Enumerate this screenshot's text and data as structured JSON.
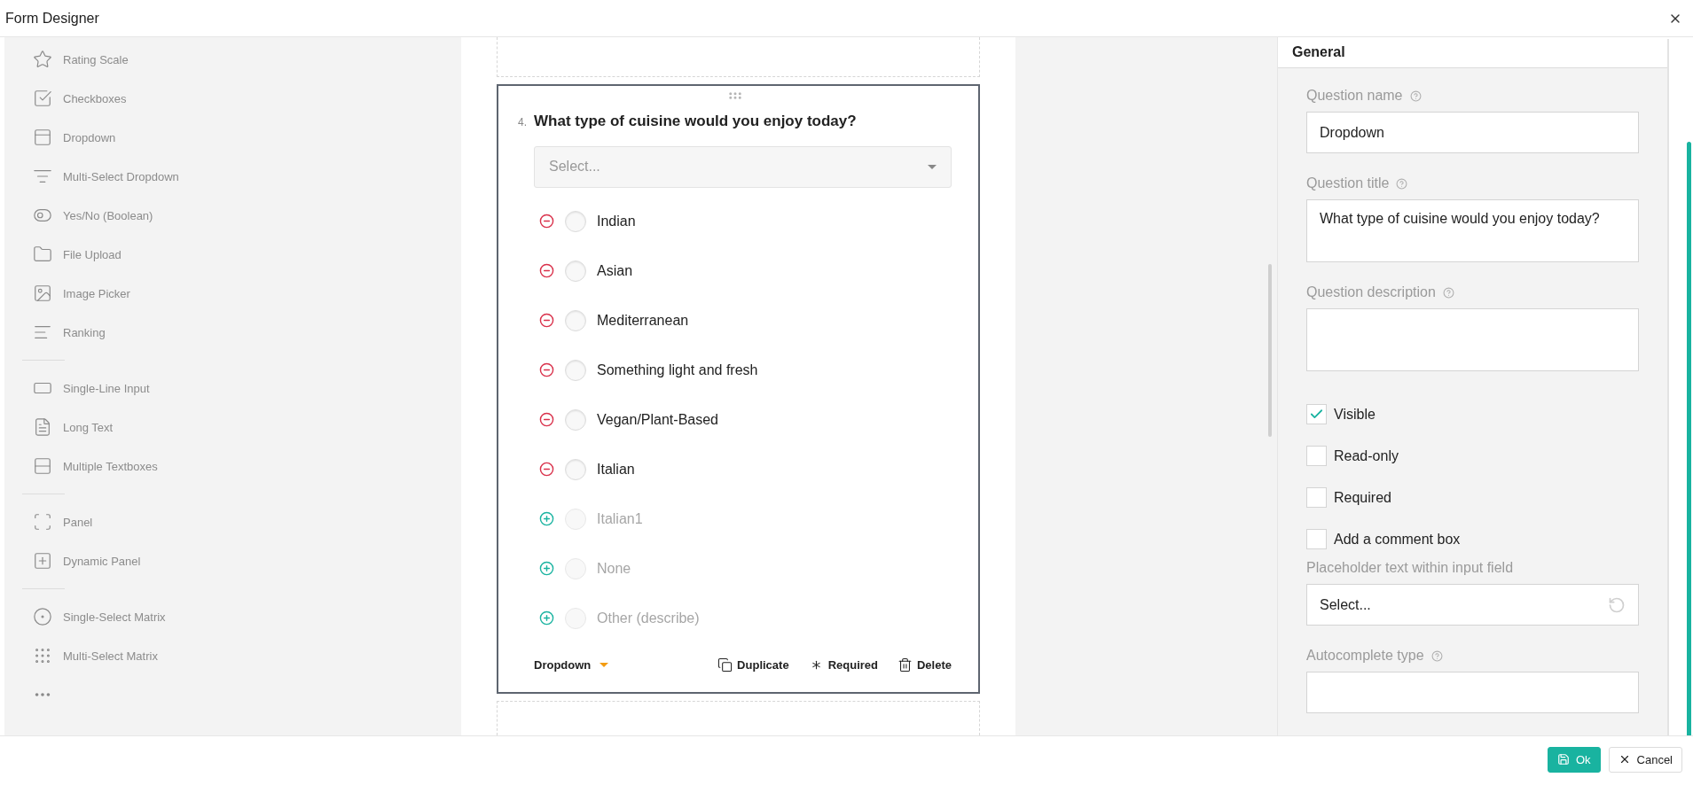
{
  "window": {
    "title": "Form Designer"
  },
  "toolbox": {
    "groups": [
      [
        {
          "label": "Rating Scale"
        },
        {
          "label": "Checkboxes"
        },
        {
          "label": "Dropdown"
        },
        {
          "label": "Multi-Select Dropdown"
        },
        {
          "label": "Yes/No (Boolean)"
        },
        {
          "label": "File Upload"
        },
        {
          "label": "Image Picker"
        },
        {
          "label": "Ranking"
        }
      ],
      [
        {
          "label": "Single-Line Input"
        },
        {
          "label": "Long Text"
        },
        {
          "label": "Multiple Textboxes"
        }
      ],
      [
        {
          "label": "Panel"
        },
        {
          "label": "Dynamic Panel"
        }
      ],
      [
        {
          "label": "Single-Select Matrix"
        },
        {
          "label": "Multi-Select Matrix"
        }
      ]
    ]
  },
  "question": {
    "number": "4.",
    "title": "What type of cuisine would you enjoy today?",
    "placeholder": "Select...",
    "options": [
      {
        "label": "Indian",
        "added": true,
        "selected": false
      },
      {
        "label": "Asian",
        "added": true,
        "selected": false
      },
      {
        "label": "Mediterranean",
        "added": true,
        "selected": false
      },
      {
        "label": "Something light and fresh",
        "added": true,
        "selected": false
      },
      {
        "label": "Vegan/Plant-Based",
        "added": true,
        "selected": false
      },
      {
        "label": "Italian",
        "added": true,
        "selected": false
      },
      {
        "label": "Italian1",
        "added": false,
        "selected": false
      },
      {
        "label": "None",
        "added": false,
        "selected": false
      },
      {
        "label": "Other (describe)",
        "added": false,
        "selected": false
      }
    ],
    "type_label": "Dropdown",
    "actions": [
      {
        "label": "Duplicate"
      },
      {
        "label": "Required"
      },
      {
        "label": "Delete"
      }
    ]
  },
  "properties": {
    "tab": "General",
    "rows": [
      {
        "kind": "text",
        "label": "Question name",
        "help": true,
        "value": "Dropdown"
      },
      {
        "kind": "textarea",
        "label": "Question title",
        "help": true,
        "value": "What type of cuisine would you enjoy today?"
      },
      {
        "kind": "textarea",
        "label": "Question description",
        "help": true
      },
      {
        "kind": "checkbox",
        "label": "Visible",
        "checked": true
      },
      {
        "kind": "checkbox",
        "label": "Read-only",
        "checked": false
      },
      {
        "kind": "checkbox",
        "label": "Required",
        "checked": false
      },
      {
        "kind": "checkbox",
        "label": "Add a comment box",
        "checked": false
      },
      {
        "kind": "reset",
        "label": "Placeholder text within input field",
        "help": false,
        "value": "Select..."
      },
      {
        "kind": "text",
        "label": "Autocomplete type",
        "help": true
      }
    ]
  },
  "footer": {
    "buttons": [
      {
        "label": "Ok",
        "kind": "primary"
      },
      {
        "label": "Cancel",
        "kind": "secondary"
      }
    ]
  }
}
